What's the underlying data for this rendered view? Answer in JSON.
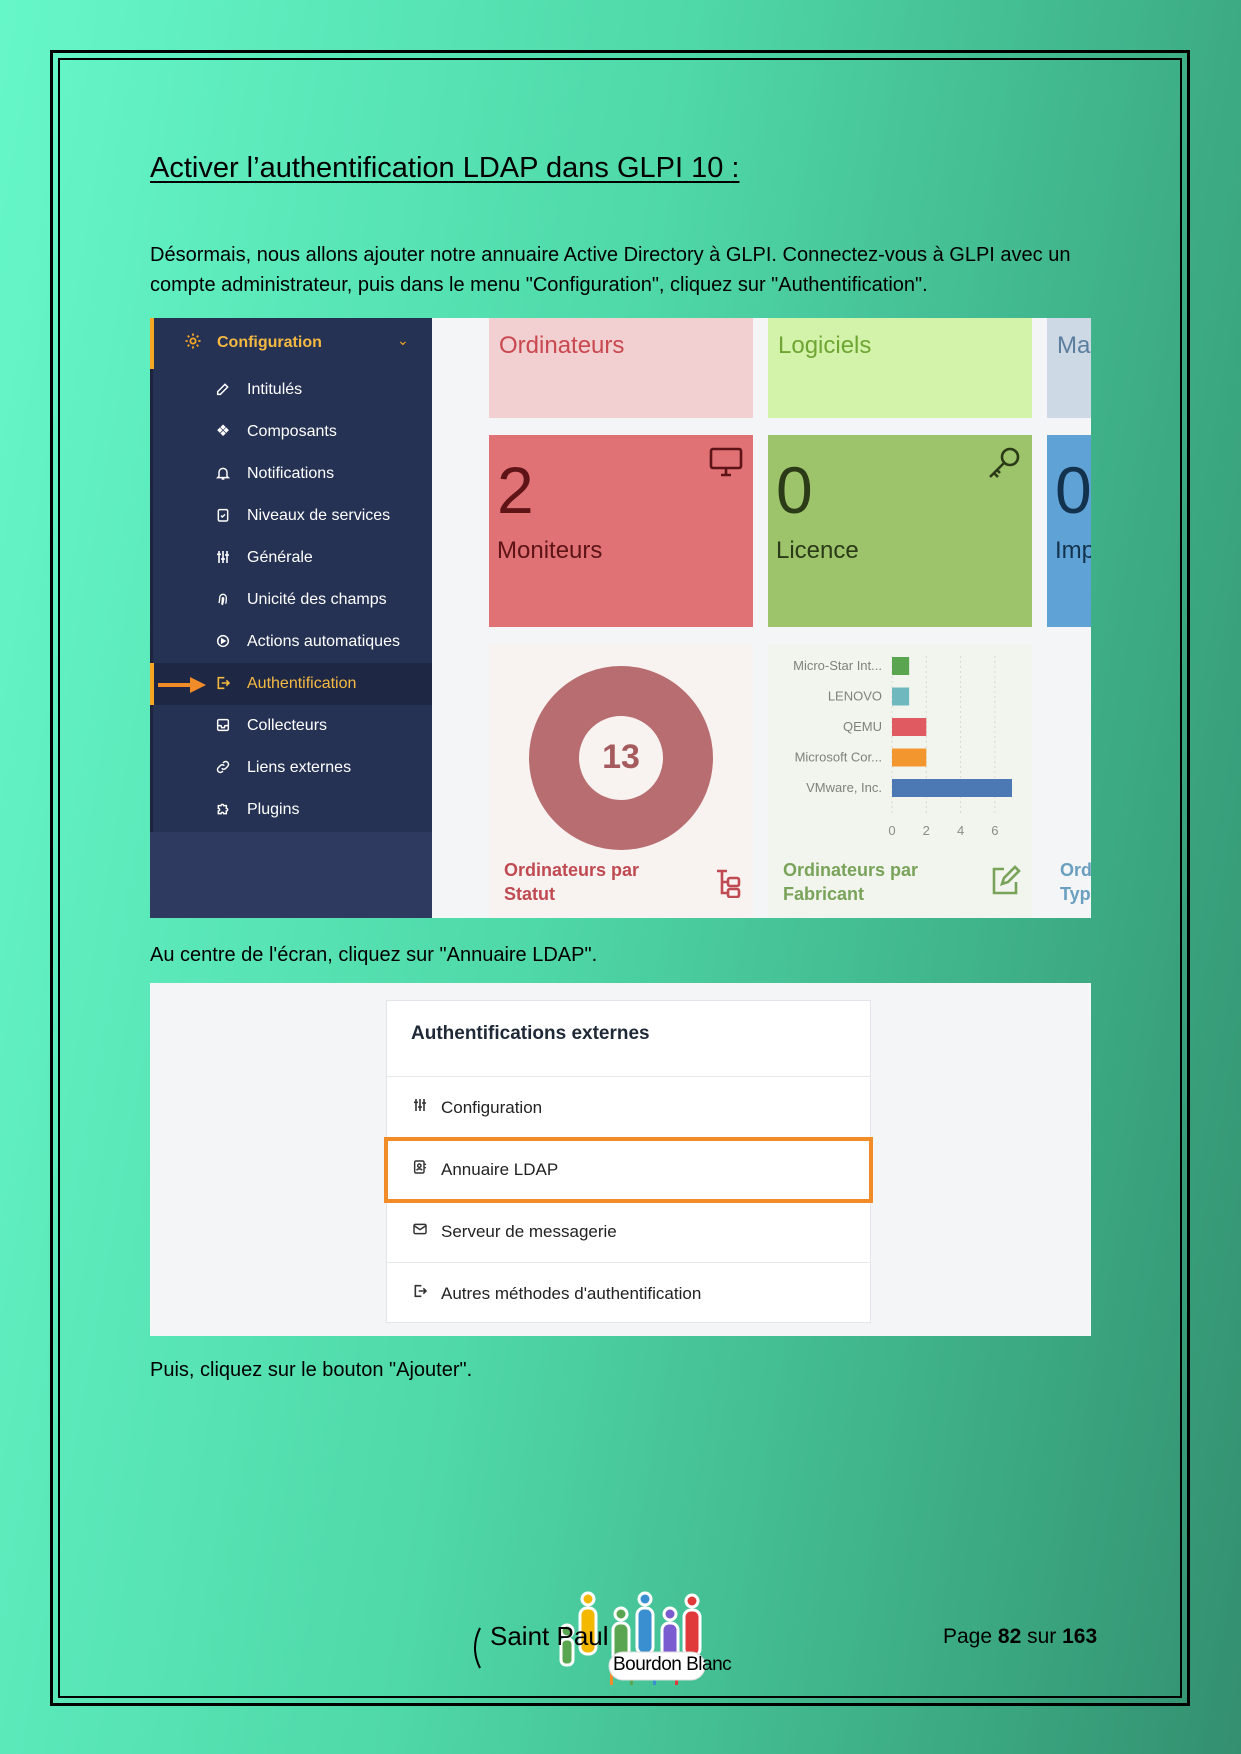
{
  "title": "Activer l’authentification LDAP dans GLPI 10 :",
  "paragraphs": {
    "intro": "Désormais, nous allons ajouter notre annuaire Active Directory à GLPI. Connectez-vous à GLPI avec un compte administrateur, puis dans le menu \"Configuration\", cliquez sur \"Authentification\".",
    "center": "Au centre de l'écran, cliquez sur \"Annuaire LDAP\".",
    "add": "Puis, cliquez sur le bouton \"Ajouter\"."
  },
  "sidebar": {
    "header": "Configuration",
    "items": [
      {
        "label": "Intitulés",
        "icon": "edit-icon"
      },
      {
        "label": "Composants",
        "icon": "components-icon"
      },
      {
        "label": "Notifications",
        "icon": "bell-icon"
      },
      {
        "label": "Niveaux de services",
        "icon": "clipboard-icon"
      },
      {
        "label": "Générale",
        "icon": "sliders-icon"
      },
      {
        "label": "Unicité des champs",
        "icon": "fingerprint-icon"
      },
      {
        "label": "Actions automatiques",
        "icon": "gear-play-icon"
      },
      {
        "label": "Authentification",
        "icon": "login-icon",
        "active": true
      },
      {
        "label": "Collecteurs",
        "icon": "inbox-icon"
      },
      {
        "label": "Liens externes",
        "icon": "link-icon"
      },
      {
        "label": "Plugins",
        "icon": "puzzle-icon"
      }
    ]
  },
  "dashboard": {
    "tiles": [
      {
        "name": "Ordinateurs"
      },
      {
        "name": "Logiciels"
      },
      {
        "name": "Ma"
      }
    ],
    "counters": [
      {
        "value": "2",
        "label": "Moniteurs",
        "icon": "monitor-icon"
      },
      {
        "value": "0",
        "label": "Licence",
        "icon": "key-icon"
      },
      {
        "value": "0",
        "label": "Imp"
      }
    ],
    "donut": {
      "value": "13",
      "title": "Ordinateurs par Statut"
    },
    "bar_card": {
      "title": "Ordinateurs par Fabricant"
    },
    "third_card": {
      "title": "Ord Typ"
    }
  },
  "chart_data": {
    "type": "bar",
    "orientation": "horizontal",
    "categories": [
      "Micro-Star Int...",
      "LENOVO",
      "QEMU",
      "Microsoft Cor...",
      "VMware, Inc."
    ],
    "values": [
      1,
      1,
      2,
      2,
      7
    ],
    "colors": [
      "#5aa650",
      "#6fb9be",
      "#e05a61",
      "#f2962d",
      "#4c78b3"
    ],
    "xticks": [
      "0",
      "2",
      "4",
      "6"
    ],
    "xlim": [
      0,
      7
    ],
    "title": "Ordinateurs par Fabricant"
  },
  "auth_panel": {
    "title": "Authentifications externes",
    "items": [
      {
        "label": "Configuration",
        "icon": "sliders-icon"
      },
      {
        "label": "Annuaire LDAP",
        "icon": "address-book-icon",
        "highlighted": true
      },
      {
        "label": "Serveur de messagerie",
        "icon": "mail-icon"
      },
      {
        "label": "Autres méthodes d'authentification",
        "icon": "login-icon"
      }
    ]
  },
  "footer": {
    "logo_text_left": "Saint Paul",
    "logo_text_badge": "Bourdon Blanc",
    "page_prefix": "Page",
    "page_current": "82",
    "page_sep": "sur",
    "page_total": "163"
  }
}
